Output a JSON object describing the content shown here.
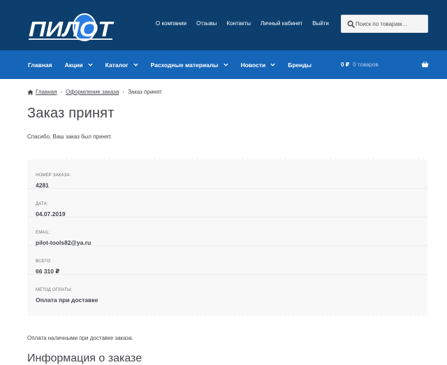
{
  "header": {
    "logo_text": "ПИЛОТ",
    "top_nav": [
      "О компании",
      "Отзывы",
      "Контакты",
      "Личный кабинет",
      "Выйти"
    ],
    "search": {
      "placeholder": "Поиск по товарам…",
      "icon": "search-icon"
    }
  },
  "main_nav": {
    "items": [
      {
        "label": "Главная",
        "dropdown": false
      },
      {
        "label": "Акции",
        "dropdown": true
      },
      {
        "label": "Каталог",
        "dropdown": true
      },
      {
        "label": "Расходные материалы",
        "dropdown": true
      },
      {
        "label": "Новости",
        "dropdown": true
      },
      {
        "label": "Бренды",
        "dropdown": false
      }
    ],
    "cart": {
      "price": "0 ₽",
      "count": "0 товаров",
      "icon": "basket-icon"
    }
  },
  "breadcrumb": {
    "home": "Главная",
    "checkout": "Оформление заказа",
    "current": "Заказ принят"
  },
  "page": {
    "title": "Заказ принят",
    "thanks": "Спасибо. Ваш заказ был принят.",
    "order_details": [
      {
        "label": "Номер заказа:",
        "value": "4281"
      },
      {
        "label": "Дата:",
        "value": "04.07.2019"
      },
      {
        "label": "Email:",
        "value": "pilot-tools82@ya.ru"
      },
      {
        "label": "Всего:",
        "value": "66 310 ₽"
      },
      {
        "label": "Метод оплаты:",
        "value": "Оплата при доставке"
      }
    ],
    "payment_note": "Оплата наличными при доставке заказа.",
    "section_title": "Информация о заказе"
  },
  "colors": {
    "header_bg": "#0c3f6e",
    "nav_bg": "#1565b8",
    "logo_accent": "#2a7de1",
    "box_bg": "#f8f8f8"
  }
}
